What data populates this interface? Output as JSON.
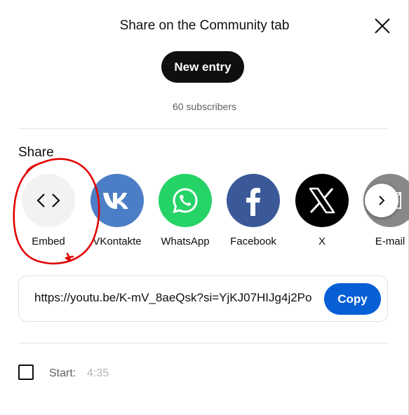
{
  "dialog": {
    "title": "Share on the Community tab",
    "new_entry_label": "New entry",
    "subscribers": "60 subscribers"
  },
  "share": {
    "heading": "Share",
    "items": [
      {
        "label": "Embed",
        "icon": "embed-code-icon",
        "color": "#f2f2f2"
      },
      {
        "label": "VKontakte",
        "icon": "vk-logo-icon",
        "color": "#4c7ec7"
      },
      {
        "label": "WhatsApp",
        "icon": "whatsapp-logo-icon",
        "color": "#25d366"
      },
      {
        "label": "Facebook",
        "icon": "facebook-logo-icon",
        "color": "#3b5998"
      },
      {
        "label": "X",
        "icon": "x-logo-icon",
        "color": "#000000"
      },
      {
        "label": "E-mail",
        "icon": "email-icon",
        "color": "#888888"
      }
    ],
    "next_icon": "chevron-right-icon"
  },
  "link": {
    "url": "https://youtu.be/K-mV_8aeQsk?si=YjKJ07HIJg4j2Po",
    "copy_label": "Copy",
    "copy_color": "#065fd4"
  },
  "start": {
    "label": "Start:",
    "time": "4:35",
    "checked": false
  },
  "annotation": {
    "color": "#e00000"
  }
}
